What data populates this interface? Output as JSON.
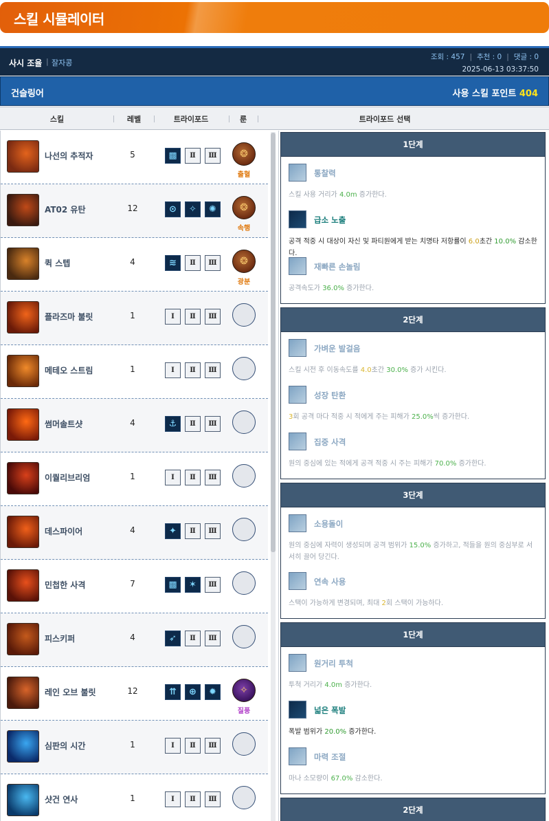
{
  "app": {
    "title": "스킬 시뮬레이터"
  },
  "post": {
    "author": "사시 조율",
    "separator": "|",
    "guild": "잘자콩",
    "views_label": "조회 : 457",
    "recommend_label": "추천 : 0",
    "comments_label": "댓글 : 0",
    "stat_separator": "|",
    "date": "2025-06-13 03:37:50"
  },
  "class_bar": {
    "class_name": "건슬링어",
    "points_label": "사용 스킬 포인트",
    "points_value": "404"
  },
  "columns": {
    "skill": "스킬",
    "level": "레벨",
    "tripod": "트라이포드",
    "rune": "룬",
    "tripod_select": "트라이포드 선택"
  },
  "skills": [
    {
      "name": "나선의 추적자",
      "level": "5",
      "tripods": [
        "▩",
        "Ⅱ",
        "Ⅲ"
      ],
      "active": [
        true,
        false,
        false
      ],
      "rune": "출혈",
      "rune_color": "orange",
      "icon_colors": [
        "#7a2a12",
        "#e3631c"
      ]
    },
    {
      "name": "AT02 유탄",
      "level": "12",
      "tripods": [
        "⊙",
        "✧",
        "✺"
      ],
      "active": [
        true,
        true,
        true
      ],
      "rune": "속행",
      "rune_color": "orange",
      "icon_colors": [
        "#3a1a10",
        "#c04a18"
      ]
    },
    {
      "name": "퀵 스텝",
      "level": "4",
      "tripods": [
        "≋",
        "Ⅱ",
        "Ⅲ"
      ],
      "active": [
        true,
        false,
        false
      ],
      "rune": "광분",
      "rune_color": "orange",
      "icon_colors": [
        "#4a2a10",
        "#d8822a"
      ]
    },
    {
      "name": "플라즈마 불릿",
      "level": "1",
      "tripods": [
        "Ⅰ",
        "Ⅱ",
        "Ⅲ"
      ],
      "active": [
        false,
        false,
        false
      ],
      "rune": "",
      "rune_color": "",
      "icon_colors": [
        "#6a1a08",
        "#f0641a"
      ]
    },
    {
      "name": "메테오 스트림",
      "level": "1",
      "tripods": [
        "Ⅰ",
        "Ⅱ",
        "Ⅲ"
      ],
      "active": [
        false,
        false,
        false
      ],
      "rune": "",
      "rune_color": "",
      "icon_colors": [
        "#6a2a08",
        "#f08a2a"
      ]
    },
    {
      "name": "썸머솔트샷",
      "level": "4",
      "tripods": [
        "⚓",
        "Ⅱ",
        "Ⅲ"
      ],
      "active": [
        true,
        false,
        false
      ],
      "rune": "",
      "rune_color": "",
      "icon_colors": [
        "#7a1a08",
        "#ff6a14"
      ]
    },
    {
      "name": "이퀄리브리엄",
      "level": "1",
      "tripods": [
        "Ⅰ",
        "Ⅱ",
        "Ⅲ"
      ],
      "active": [
        false,
        false,
        false
      ],
      "rune": "",
      "rune_color": "",
      "icon_colors": [
        "#4a0a08",
        "#d8401a"
      ]
    },
    {
      "name": "데스파이어",
      "level": "4",
      "tripods": [
        "✦",
        "Ⅱ",
        "Ⅲ"
      ],
      "active": [
        true,
        false,
        false
      ],
      "rune": "",
      "rune_color": "",
      "icon_colors": [
        "#6a1a08",
        "#f0601a"
      ]
    },
    {
      "name": "민첩한 사격",
      "level": "7",
      "tripods": [
        "▩",
        "✶",
        "Ⅲ"
      ],
      "active": [
        true,
        true,
        false
      ],
      "rune": "",
      "rune_color": "",
      "icon_colors": [
        "#5a1208",
        "#e8501c"
      ]
    },
    {
      "name": "피스키퍼",
      "level": "4",
      "tripods": [
        "➶",
        "Ⅱ",
        "Ⅲ"
      ],
      "active": [
        true,
        false,
        false
      ],
      "rune": "",
      "rune_color": "",
      "icon_colors": [
        "#5a1a08",
        "#c45a1c"
      ]
    },
    {
      "name": "레인 오브 불릿",
      "level": "12",
      "tripods": [
        "⇈",
        "⊕",
        "✹"
      ],
      "active": [
        true,
        true,
        true
      ],
      "rune": "질풍",
      "rune_color": "purple",
      "icon_colors": [
        "#4a1a0c",
        "#d8642a"
      ]
    },
    {
      "name": "심판의 시간",
      "level": "1",
      "tripods": [
        "Ⅰ",
        "Ⅱ",
        "Ⅲ"
      ],
      "active": [
        false,
        false,
        false
      ],
      "rune": "",
      "rune_color": "",
      "icon_colors": [
        "#0a2a6a",
        "#3aa6f0"
      ]
    },
    {
      "name": "샷건 연사",
      "level": "1",
      "tripods": [
        "Ⅰ",
        "Ⅱ",
        "Ⅲ"
      ],
      "active": [
        false,
        false,
        false
      ],
      "rune": "",
      "rune_color": "",
      "icon_colors": [
        "#0a3a6a",
        "#4ab8f0"
      ]
    }
  ],
  "stages": [
    {
      "title": "1단계",
      "options": [
        {
          "name": "통찰력",
          "selected": false,
          "desc_html": "스킬 사용 거리가 <span class='hl-g'>4.0m</span> 증가한다."
        },
        {
          "name": "급소 노출",
          "selected": true,
          "desc_html": "공격 적중 시 대상이 자신 및 파티원에게 받는 치명타 저항률이 <span class='hl-y'>6.0</span>초간 <span class='hl-g'>10.0%</span> 감소한다."
        },
        {
          "name": "재빠른 손놀림",
          "selected": false,
          "desc_html": "공격속도가 <span class='hl-g'>36.0%</span> 증가한다."
        }
      ]
    },
    {
      "title": "2단계",
      "options": [
        {
          "name": "가벼운 발걸음",
          "selected": false,
          "desc_html": "스킬 시전 후 이동속도를 <span class='hl-y'>4.0</span>초간 <span class='hl-g'>30.0%</span> 증가 시킨다."
        },
        {
          "name": "성장 탄환",
          "selected": false,
          "desc_html": "<span class='hl-y'>3</span>회 공격 마다 적중 시 적에게 주는 피해가 <span class='hl-g'>25.0%</span>씩 증가한다."
        },
        {
          "name": "집중 사격",
          "selected": false,
          "desc_html": "원의 중심에 있는 적에게 공격 적중 시 주는 피해가 <span class='hl-g'>70.0%</span> 증가한다."
        }
      ]
    },
    {
      "title": "3단계",
      "options": [
        {
          "name": "소용돌이",
          "selected": false,
          "desc_html": "원의 중심에 자력이 생성되며 공격 범위가 <span class='hl-g'>15.0%</span> 증가하고, 적들을 원의 중심부로 서서히 끌어 당긴다."
        },
        {
          "name": "연속 사용",
          "selected": false,
          "desc_html": "스택이 가능하게 변경되며, 최대 <span class='hl-y'>2</span>회 스택이 가능하다."
        }
      ]
    },
    {
      "title": "1단계",
      "options": [
        {
          "name": "원거리 투척",
          "selected": false,
          "desc_html": "투척 거리가 <span class='hl-g'>4.0m</span> 증가한다."
        },
        {
          "name": "넓은 폭발",
          "selected": true,
          "desc_html": "폭발 범위가 <span class='hl-g'>20.0%</span> 증가한다."
        },
        {
          "name": "마력 조절",
          "selected": false,
          "desc_html": "마나 소모량이 <span class='hl-g'>67.0%</span> 감소한다."
        }
      ]
    },
    {
      "title": "2단계",
      "options": []
    }
  ]
}
